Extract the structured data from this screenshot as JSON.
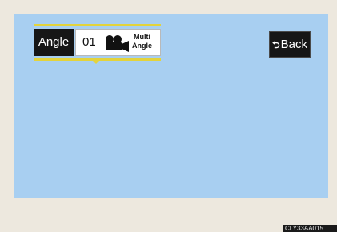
{
  "angle_control": {
    "label": "Angle",
    "number": "01",
    "camera_icon": "video-camera-icon",
    "mode_line1": "Multi",
    "mode_line2": "Angle"
  },
  "back_button": {
    "icon": "return-arrow-icon",
    "icon_glyph": "⮌",
    "label": "Back"
  },
  "figure_code": "CLY33AA015",
  "colors": {
    "screen_background": "#a8cff1",
    "frame_background": "#ede8de",
    "highlight_yellow": "#e3d33c",
    "button_black": "#161616"
  }
}
